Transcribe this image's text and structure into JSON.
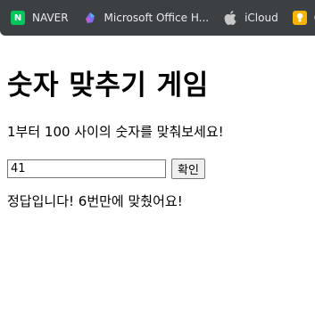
{
  "bookmarks": [
    {
      "label": "NAVER",
      "icon": "naver-icon"
    },
    {
      "label": "Microsoft Office H...",
      "icon": "microsoft-office-icon"
    },
    {
      "label": "iCloud",
      "icon": "apple-icon"
    },
    {
      "label": "Go",
      "icon": "google-keep-icon"
    }
  ],
  "page": {
    "title": "숫자 맞추기 게임",
    "instruction": "1부터 100 사이의 숫자를 맞춰보세요!",
    "input_value": "41",
    "confirm_label": "확인",
    "result": "정답입니다! 6번만에 맞췄어요!"
  },
  "colors": {
    "bookmark_bar_bg": "#3c4043",
    "naver_green": "#03c75a",
    "keep_yellow": "#f7b500"
  }
}
